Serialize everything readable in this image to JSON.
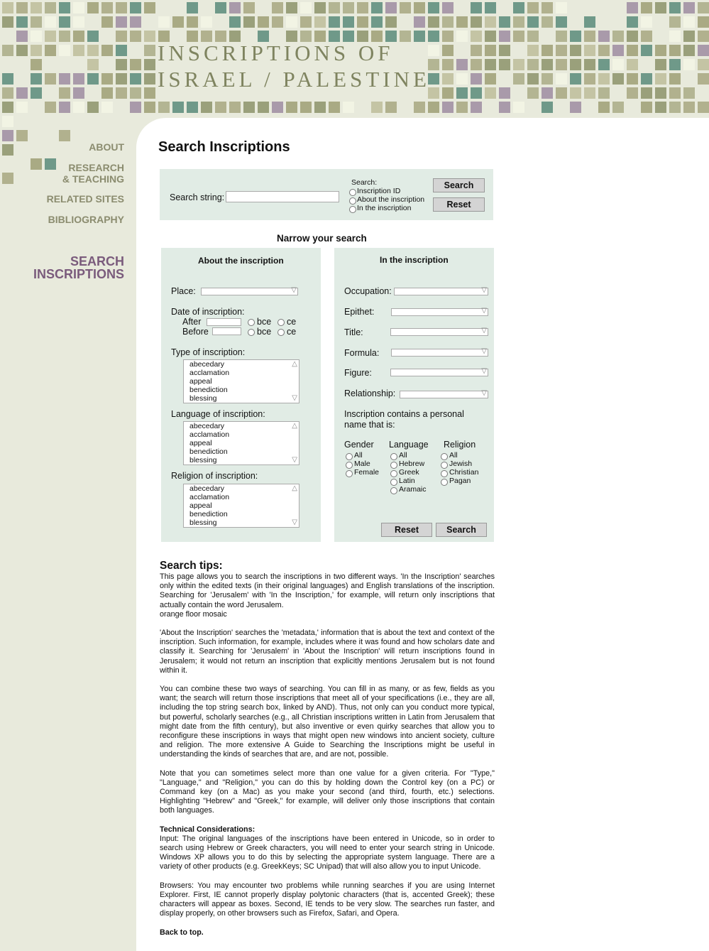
{
  "site_title": [
    "INSCRIPTIONS OF",
    "ISRAEL / PALESTINE"
  ],
  "colors": {
    "background": "#e8eadc",
    "accent": "#7a5b7c",
    "nav": "#8b8c6f",
    "panel": "#e1ece5"
  },
  "nav": {
    "about": "ABOUT",
    "research_1": "RESEARCH",
    "research_2": "& TEACHING",
    "related": "RELATED SITES",
    "bibliography": "BIBLIOGRAPHY",
    "search_1": "SEARCH",
    "search_2": "INSCRIPTIONS"
  },
  "page_title": "Search Inscriptions",
  "search_bar": {
    "string_label": "Search string:",
    "string_value": "",
    "scope_label": "Search:",
    "scope_options": [
      "Inscription ID",
      "About the inscription",
      "In the inscription"
    ],
    "search_button": "Search",
    "reset_button": "Reset"
  },
  "narrow_title": "Narrow your search",
  "about_panel": {
    "title": "About the inscription",
    "place_label": "Place:",
    "date_label": "Date of inscription:",
    "after_label": "After",
    "before_label": "Before",
    "bce": "bce",
    "ce": "ce",
    "type_label": "Type of inscription:",
    "language_label": "Language of inscription:",
    "religion_label": "Religion of inscription:",
    "list_options": [
      "abecedary",
      "acclamation",
      "appeal",
      "benediction",
      "blessing"
    ]
  },
  "in_panel": {
    "title": "In the inscription",
    "occupation_label": "Occupation:",
    "epithet_label": "Epithet:",
    "title_label": "Title:",
    "formula_label": "Formula:",
    "figure_label": "Figure:",
    "relationship_label": "Relationship:",
    "personal_name_1": "Inscription contains a personal",
    "personal_name_2": "name that is:",
    "gender_label": "Gender",
    "gender_options": [
      "All",
      "Male",
      "Female"
    ],
    "language_label": "Language",
    "language_options": [
      "All",
      "Hebrew",
      "Greek",
      "Latin",
      "Aramaic"
    ],
    "religion_label": "Religion",
    "religion_options": [
      "All",
      "Jewish",
      "Christian",
      "Pagan"
    ],
    "reset_button": "Reset",
    "search_button": "Search"
  },
  "tips": {
    "title": "Search tips:",
    "p1": "This page allows you to search the inscriptions in two different ways. 'In the Inscription' searches only within the edited texts (in their original languages) and English translations of the inscription. Searching for 'Jerusalem' with 'In the Inscription,' for example, will return only inscriptions that actually contain the word Jerusalem.",
    "p1b": "orange floor mosaic",
    "p2": "'About the Inscription' searches the 'metadata,' information that is about the text and context of the inscription. Such information, for example, includes where it was found and how scholars date and classify it. Searching for 'Jerusalem' in 'About the Inscription' will return inscriptions found in Jerusalem; it would not return an inscription that explicitly mentions Jerusalem but is not found within it.",
    "p3": "You can combine these two ways of searching. You can fill in as many, or as few, fields as you want; the search will return those inscriptions that meet all of your specifications (i.e., they are all, including the top string search box, linked by AND). Thus, not only can you conduct more typical, but powerful, scholarly searches (e.g., all Christian inscriptions written in Latin from Jerusalem that might date from the fifth century), but also inventive or even quirky searches that allow you to reconfigure these inscriptions in ways that might open new windows into ancient society, culture and religion. The more extensive A Guide to Searching the Inscriptions might be useful in understanding the kinds of searches that are, and are not, possible.",
    "p4": "Note that you can sometimes select more than one value for a given criteria. For \"Type,\" \"Language,\" and \"Religion,\" you can do this by holding down the Control key (on a PC) or Command key (on a Mac) as you make your second (and third, fourth, etc.) selections. Highlighting \"Hebrew\" and \"Greek,\" for example, will deliver only those inscriptions that contain both languages.",
    "tech_title": "Technical Considerations:",
    "p5": "Input: The original languages of the inscriptions have been entered in Unicode, so in order to search using Hebrew or Greek characters, you will need to enter your search string in Unicode. Windows XP allows you to do this by selecting the appropriate system language. There are a variety of other products (e.g. GreekKeys; SC Unipad) that will also allow you to input Unicode.",
    "p6": "Browsers: You may encounter two problems while running searches if you are using Internet Explorer. First, IE cannot properly display polytonic characters (that is, accented Greek); these characters will appear as boxes. Second, IE tends to be very slow. The searches run faster, and display properly, on other browsers such as Firefox, Safari, and Opera.",
    "back_to_top": "Back to top."
  }
}
